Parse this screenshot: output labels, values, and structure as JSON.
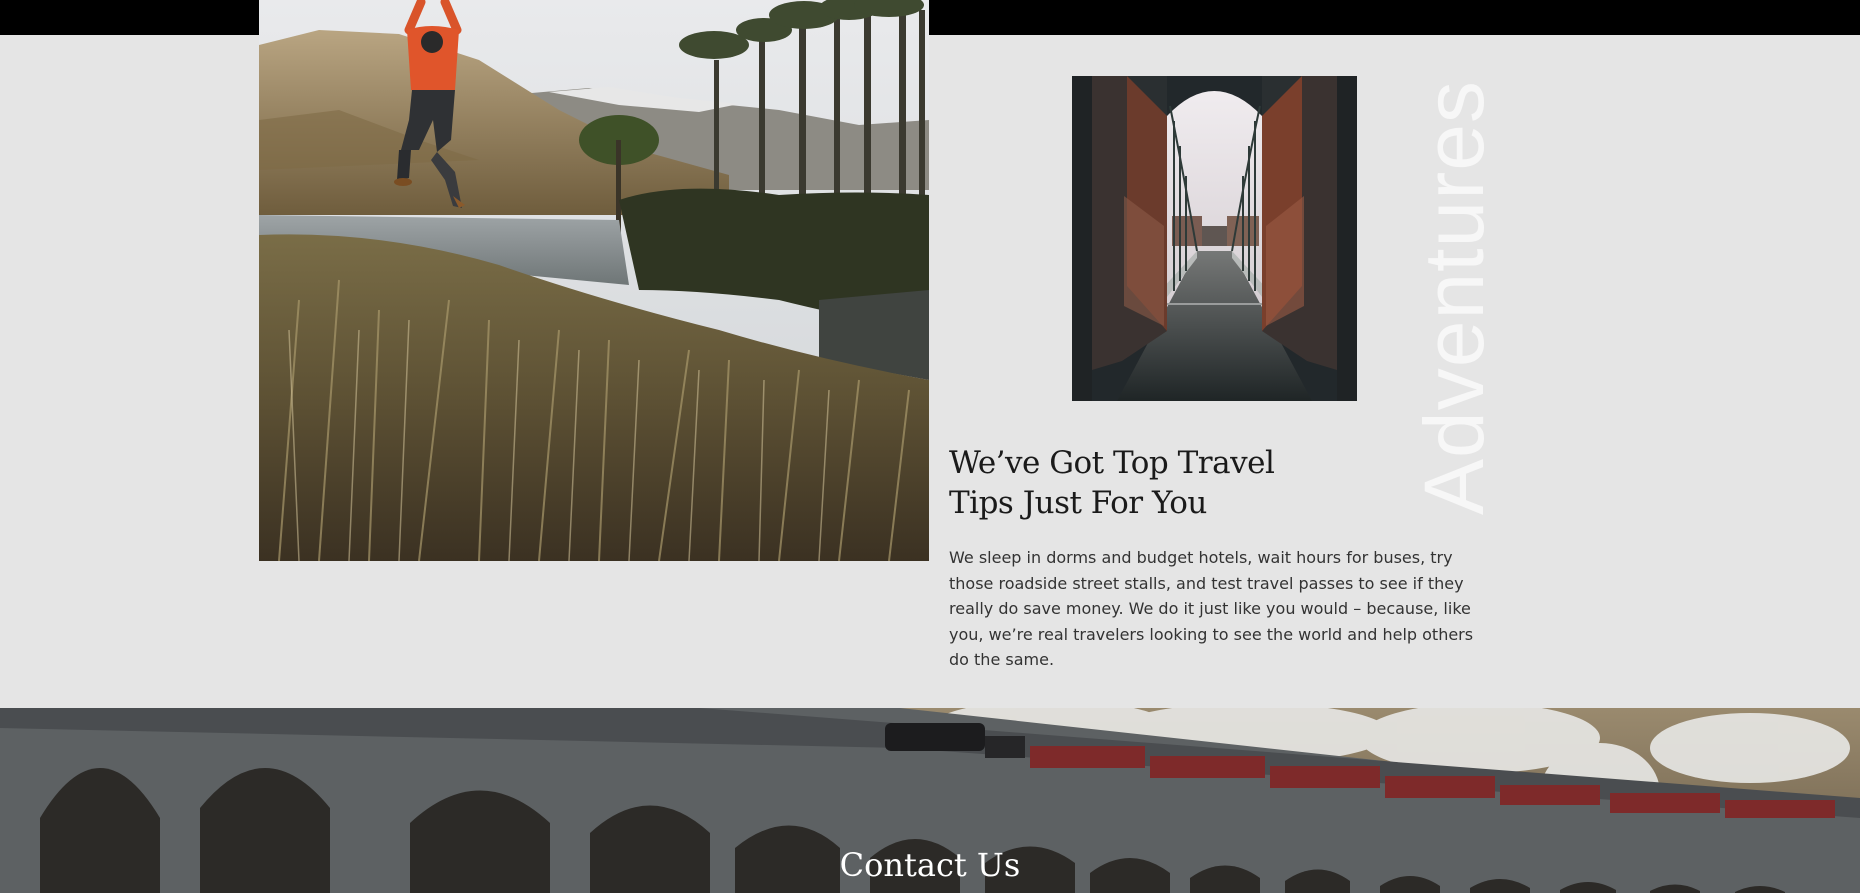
{
  "colors": {
    "page_background": "#e5e5e5",
    "top_bar": "#000000",
    "headline_text": "#1a1a1a",
    "body_text": "#333333",
    "vertical_word": "#f7f7f7",
    "contact_title": "#ffffff"
  },
  "images": {
    "hero": "photo-man-jumping-over-lake-and-hills",
    "bridge": "photo-suspension-bridge-through-stone-arch",
    "contact_background": "photo-steam-train-on-stone-viaduct"
  },
  "intro": {
    "vertical_word": "Adventures",
    "headline_line1": "We’ve Got Top Travel",
    "headline_line2": "Tips Just For You",
    "body": "We sleep in dorms and budget hotels, wait hours for buses, try those roadside street stalls, and test travel passes to see if they really do save money. We do it just like you would – because, like you, we’re real travelers looking to see the world and help others do the same."
  },
  "contact": {
    "title": "Contact Us"
  }
}
